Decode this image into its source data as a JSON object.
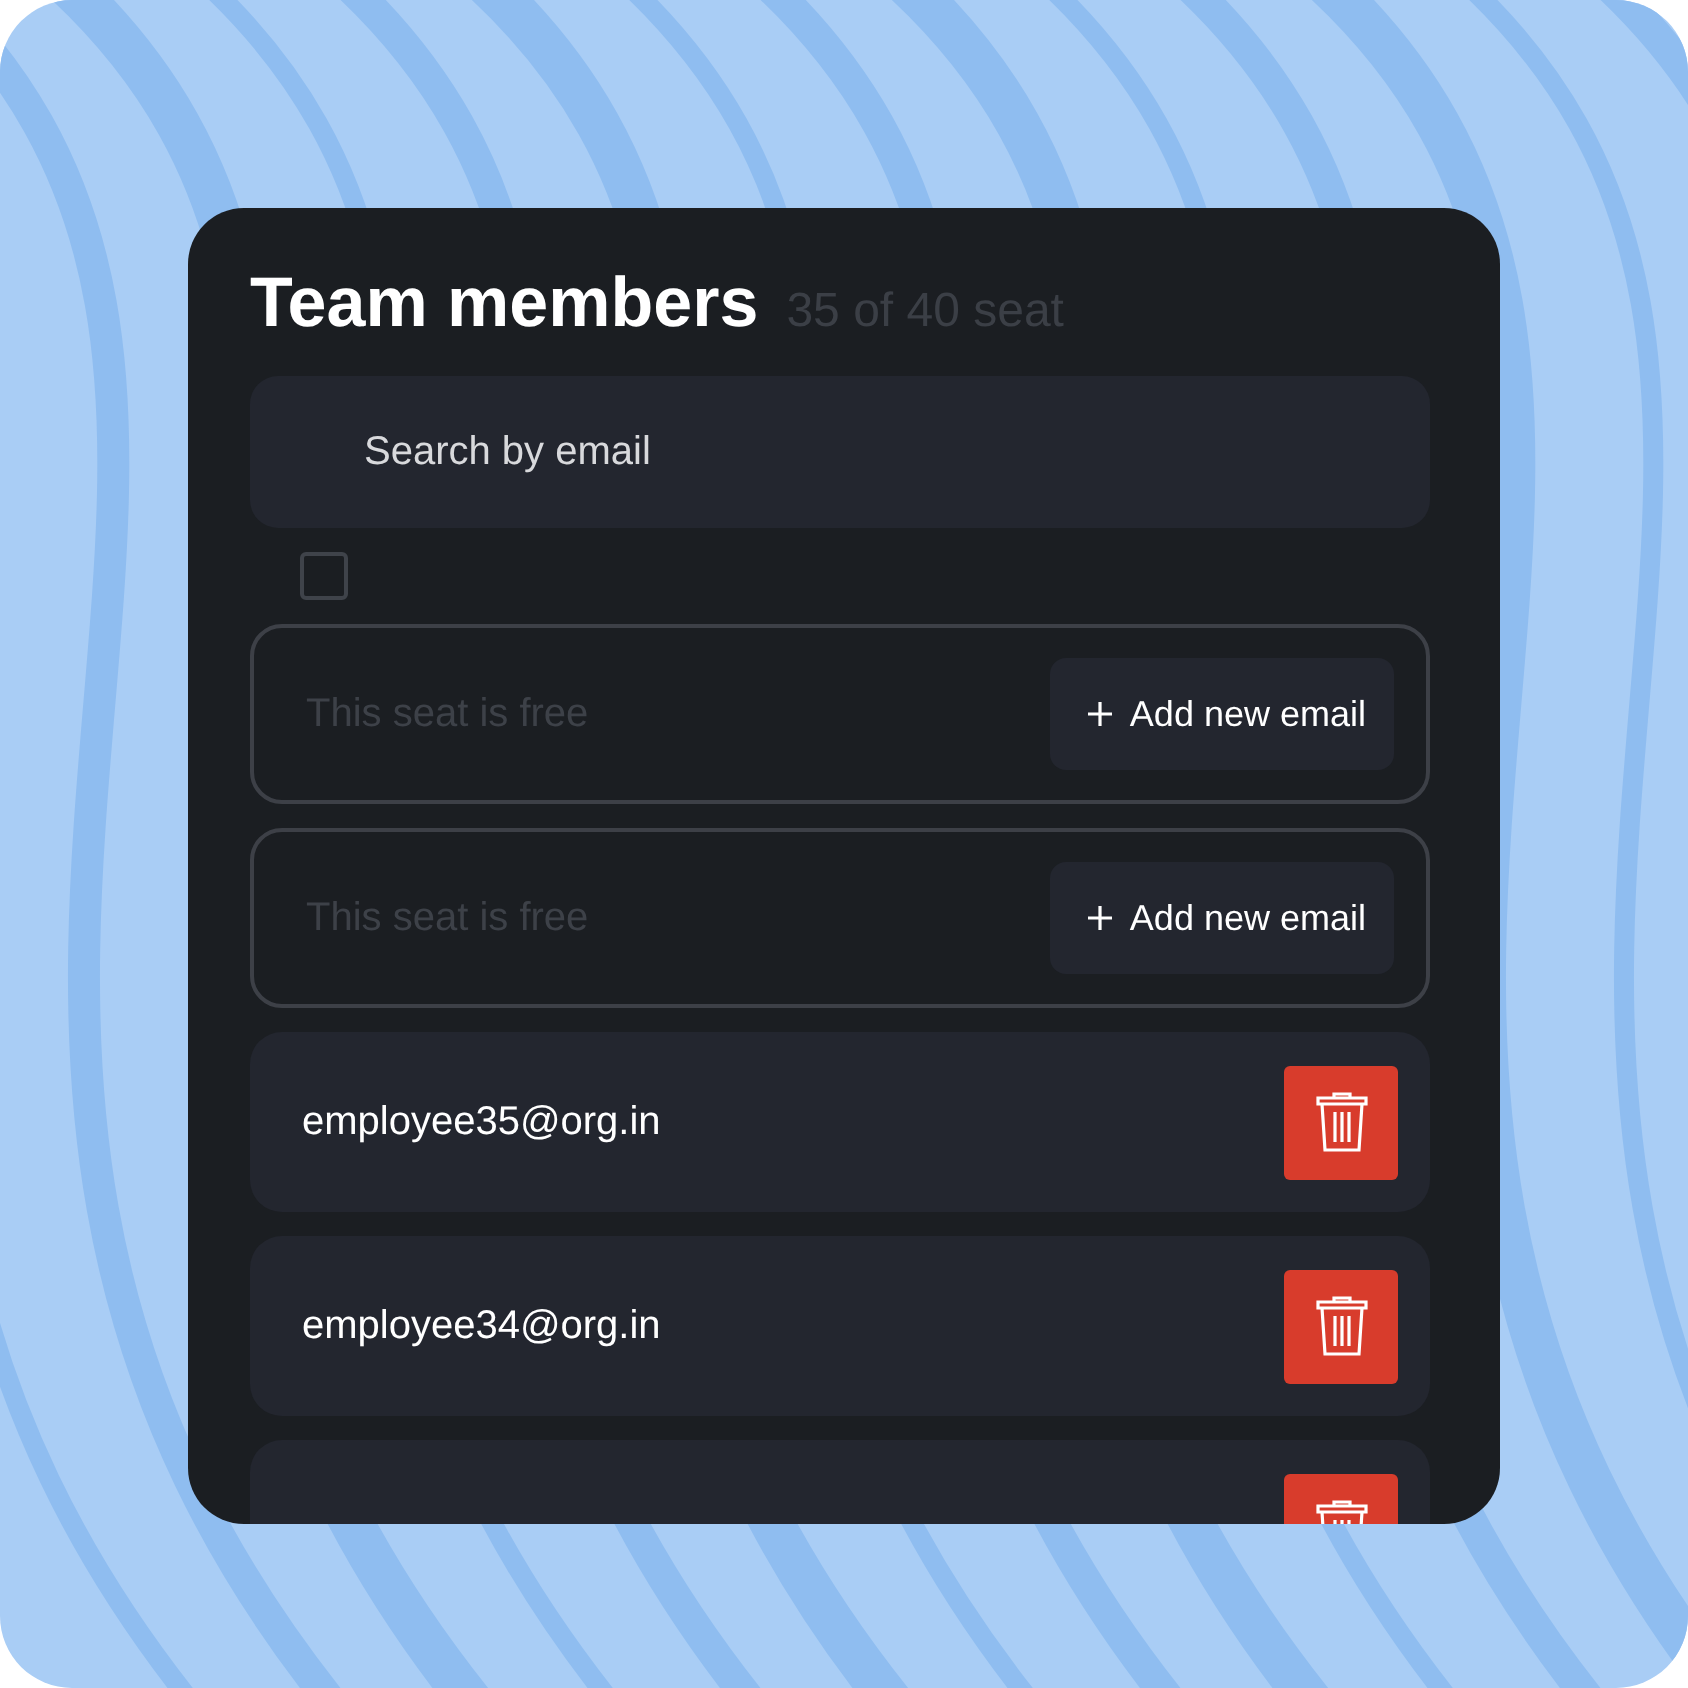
{
  "title": "Team members",
  "seat_count": "35 of 40 seat",
  "search": {
    "placeholder": "Search by email"
  },
  "select_all": {
    "checked": false
  },
  "seats": [
    {
      "kind": "free",
      "text": "This seat is free",
      "button": "Add new email"
    },
    {
      "kind": "free",
      "text": "This seat is free",
      "button": "Add new email"
    },
    {
      "kind": "member",
      "email": "employee35@org.in"
    },
    {
      "kind": "member",
      "email": "employee34@org.in"
    },
    {
      "kind": "member"
    }
  ]
}
